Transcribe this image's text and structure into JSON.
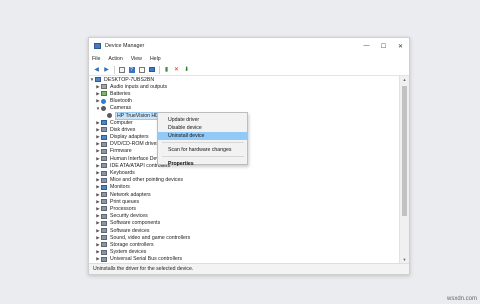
{
  "window": {
    "title": "Device Manager",
    "minimize_glyph": "—",
    "maximize_glyph": "☐",
    "close_glyph": "✕"
  },
  "menu": [
    "File",
    "Action",
    "View",
    "Help"
  ],
  "toolbar_icons": [
    "back-icon",
    "forward-icon",
    "properties-icon",
    "help-icon",
    "scan-icon",
    "update-driver-icon",
    "disable-icon",
    "uninstall-icon",
    "download-icon"
  ],
  "tree": {
    "root": "DESKTOP-7UBS2BN",
    "cameras_child": "HP TrueVision HD",
    "categories": [
      "Audio inputs and outputs",
      "Batteries",
      "Bluetooth",
      "Cameras",
      "Computer",
      "Disk drives",
      "Display adapters",
      "DVD/CD-ROM drives",
      "Firmware",
      "Human Interface Devices",
      "IDE ATA/ATAPI controllers",
      "Keyboards",
      "Mice and other pointing devices",
      "Monitors",
      "Network adapters",
      "Print queues",
      "Processors",
      "Security devices",
      "Software components",
      "Software devices",
      "Sound, video and game controllers",
      "Storage controllers",
      "System devices",
      "Universal Serial Bus controllers"
    ]
  },
  "context_menu": {
    "items": [
      "Update driver",
      "Disable device",
      "Uninstall device"
    ],
    "items2": [
      "Scan for hardware changes"
    ],
    "properties": "Properties",
    "highlighted": "Uninstall device"
  },
  "status": "Uninstalls the driver for the selected device.",
  "watermark": "wsxdn.com",
  "colors": {
    "selection": "#cde4f7",
    "menu_highlight": "#91c9f7",
    "desktop": "#ebecef"
  }
}
